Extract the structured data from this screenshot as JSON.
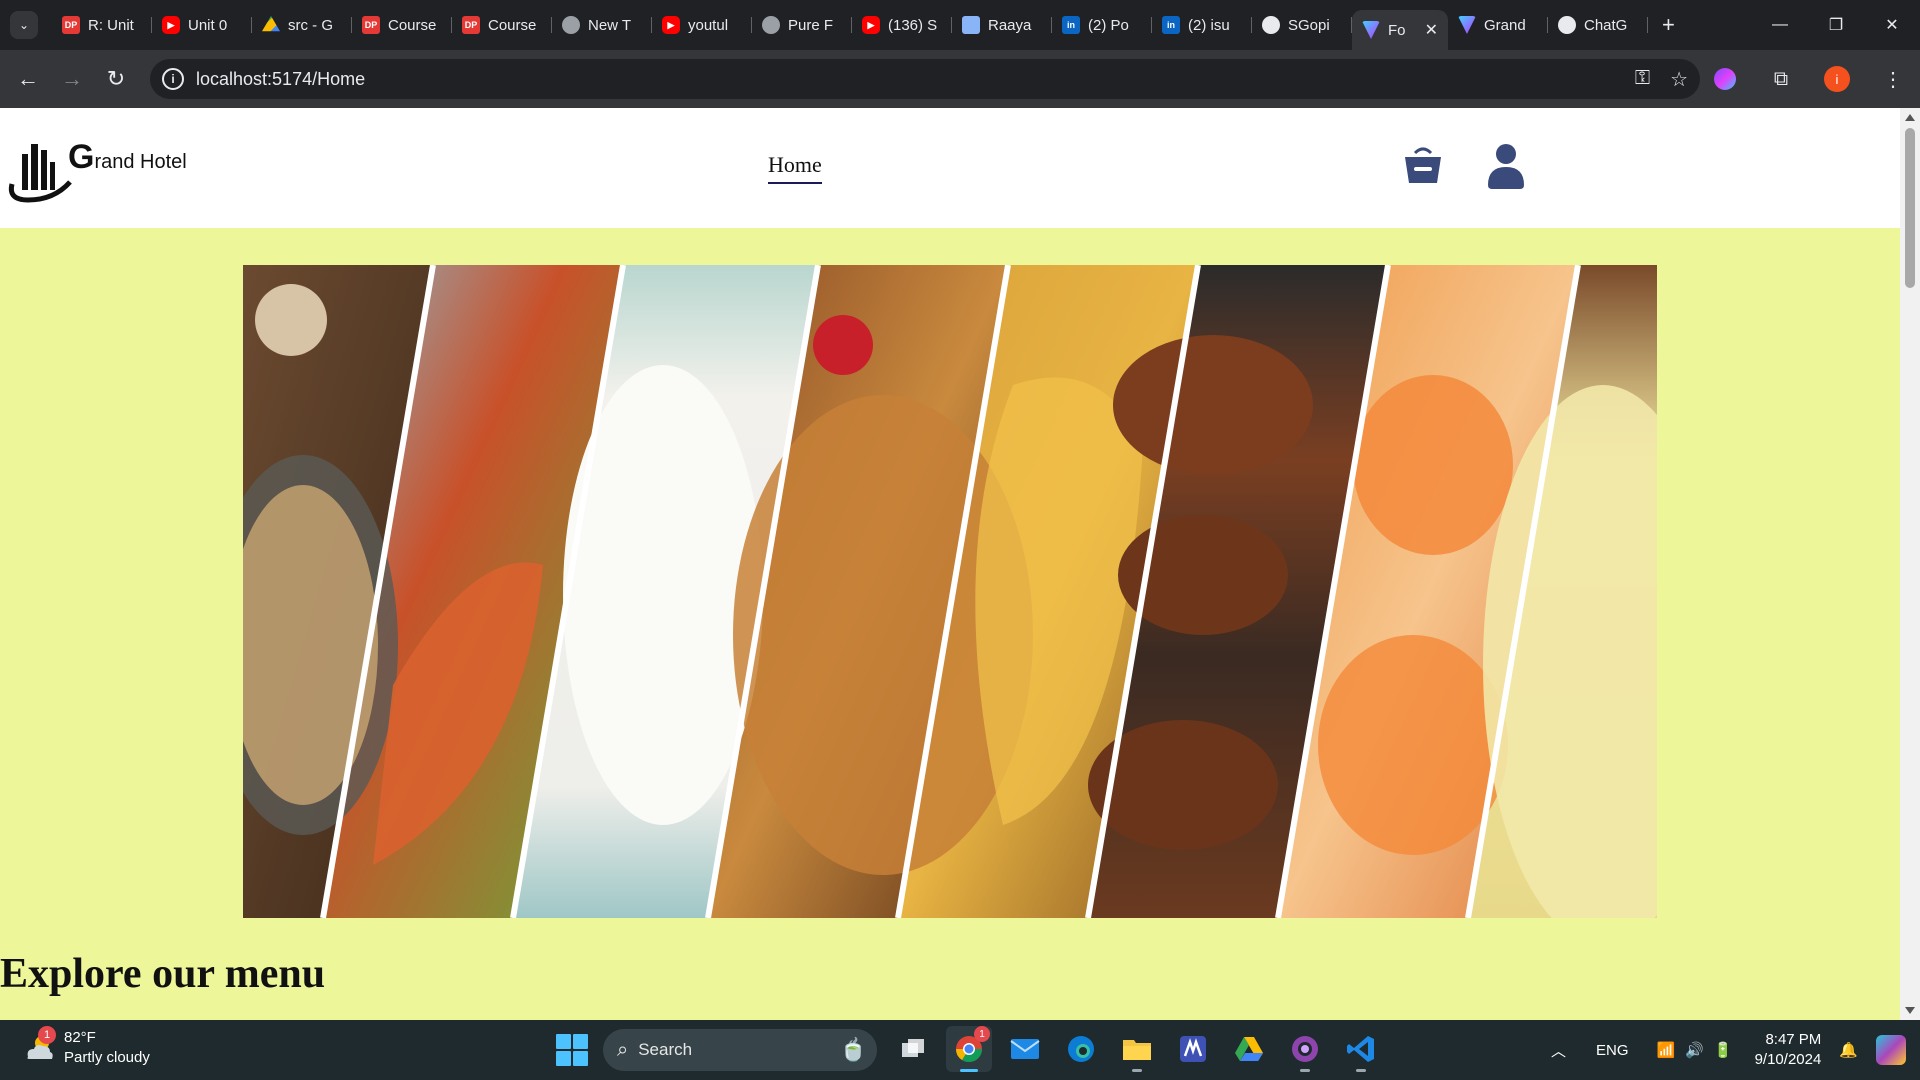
{
  "browser": {
    "tabs": [
      {
        "title": "R: Unit",
        "icon": "dp-icon",
        "iconText": "DP"
      },
      {
        "title": "Unit 0",
        "icon": "youtube-icon",
        "iconText": "▶"
      },
      {
        "title": "src - G",
        "icon": "drive-icon",
        "iconText": ""
      },
      {
        "title": "Course",
        "icon": "dp-icon",
        "iconText": "DP"
      },
      {
        "title": "Course",
        "icon": "dp-icon",
        "iconText": "DP"
      },
      {
        "title": "New T",
        "icon": "globe-icon",
        "iconText": ""
      },
      {
        "title": "youtul",
        "icon": "youtube-icon",
        "iconText": "▶"
      },
      {
        "title": "Pure F",
        "icon": "globe-icon",
        "iconText": ""
      },
      {
        "title": "(136) S",
        "icon": "youtube-icon",
        "iconText": "▶"
      },
      {
        "title": "Raaya",
        "icon": "book-icon",
        "iconText": ""
      },
      {
        "title": "(2) Po",
        "icon": "linkedin-icon",
        "iconText": "in"
      },
      {
        "title": "(2) isu",
        "icon": "linkedin-icon",
        "iconText": "in"
      },
      {
        "title": "SGopi",
        "icon": "github-icon",
        "iconText": ""
      },
      {
        "title": "Fo",
        "icon": "vite-icon",
        "iconText": "",
        "active": true
      },
      {
        "title": "Grand",
        "icon": "vite-icon",
        "iconText": ""
      },
      {
        "title": "ChatG",
        "icon": "chatgpt-icon",
        "iconText": ""
      }
    ],
    "url": "localhost:5174/Home",
    "profile_initial": "i"
  },
  "page": {
    "brand_cap": "G",
    "brand_rest": "rand Hotel",
    "nav_home": "Home",
    "section_title": "Explore our menu",
    "colors": {
      "background": "#eef69a",
      "header": "#ffffff",
      "icon": "#3a4a7a"
    }
  },
  "taskbar": {
    "weather_temp": "82°F",
    "weather_desc": "Partly cloudy",
    "weather_badge": "1",
    "search_label": "Search",
    "lang": "ENG",
    "time": "8:47 PM",
    "date": "9/10/2024",
    "chrome_badge": "1"
  }
}
